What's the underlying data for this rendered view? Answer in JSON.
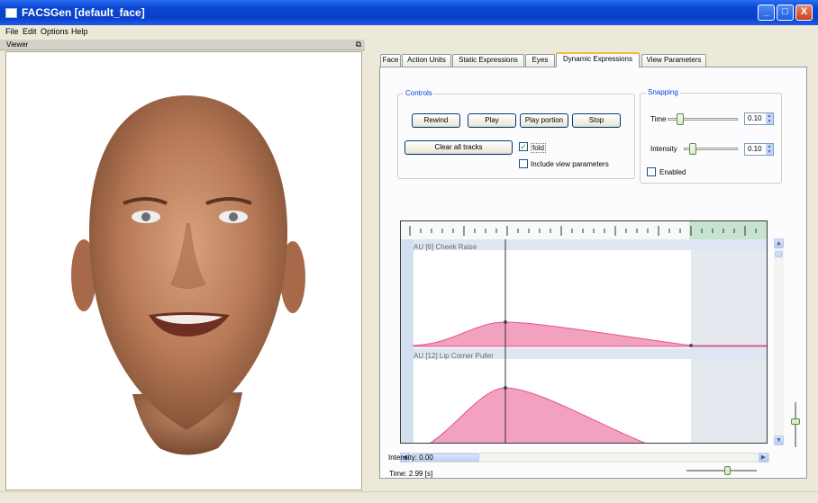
{
  "window": {
    "title": "FACSGen [default_face]",
    "minimize_label": "_",
    "maximize_label": "□",
    "close_label": "X"
  },
  "menu": [
    "File",
    "Edit",
    "Options",
    "Help"
  ],
  "viewer": {
    "title": "Viewer"
  },
  "tabs": [
    {
      "label": "Face",
      "active": false
    },
    {
      "label": "Action Units",
      "active": false
    },
    {
      "label": "Static Expressions",
      "active": false
    },
    {
      "label": "Eyes",
      "active": false
    },
    {
      "label": "Dynamic Expressions",
      "active": true
    },
    {
      "label": "View Parameters",
      "active": false
    }
  ],
  "controls": {
    "title": "Controls",
    "rewind": "Rewind",
    "play": "Play",
    "play_portion": "Play portion",
    "stop": "Stop",
    "clear_all": "Clear all tracks",
    "fold_label": "fold",
    "fold_checked": true,
    "include_view_label": "Include view parameters",
    "include_view_checked": false
  },
  "snapping": {
    "title": "Snapping",
    "time_label": "Time",
    "time_value": "0.10",
    "intensity_label": "Intensity",
    "intensity_value": "0.10",
    "enabled_label": "Enabled",
    "enabled_checked": false
  },
  "timeline": {
    "tracks": [
      {
        "label": "AU [6] Cheek Raise"
      },
      {
        "label": "AU [12] Lip Corner Puller"
      }
    ]
  },
  "status": {
    "time": "Time: 2.99 [s]",
    "intensity": "Intensity: 0.00"
  },
  "colors": {
    "curve_fill": "#f3a1c1",
    "curve_stroke": "#e0558c",
    "track_header": "#dfe6f3",
    "ruler": "#bfe0c9",
    "accent": "#0046d5"
  }
}
